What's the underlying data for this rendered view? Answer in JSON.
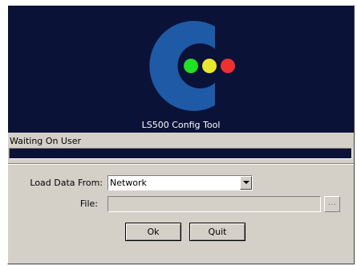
{
  "splash": {
    "app_title": "LS500 Config Tool",
    "logo": {
      "icon": "traffic-light-c-logo-icon",
      "c_color": "#1e5aa6",
      "light_colors": [
        "#22e022",
        "#e8e830",
        "#f03030"
      ]
    },
    "background_color": "#0b1238"
  },
  "status": {
    "text": "Waiting On User",
    "progress_color": "#0b1238"
  },
  "form": {
    "load_label": "Load Data From:",
    "load_value": "Network",
    "file_label": "File:",
    "file_value": "",
    "browse_label": "..."
  },
  "buttons": {
    "ok": "Ok",
    "quit": "Quit"
  }
}
